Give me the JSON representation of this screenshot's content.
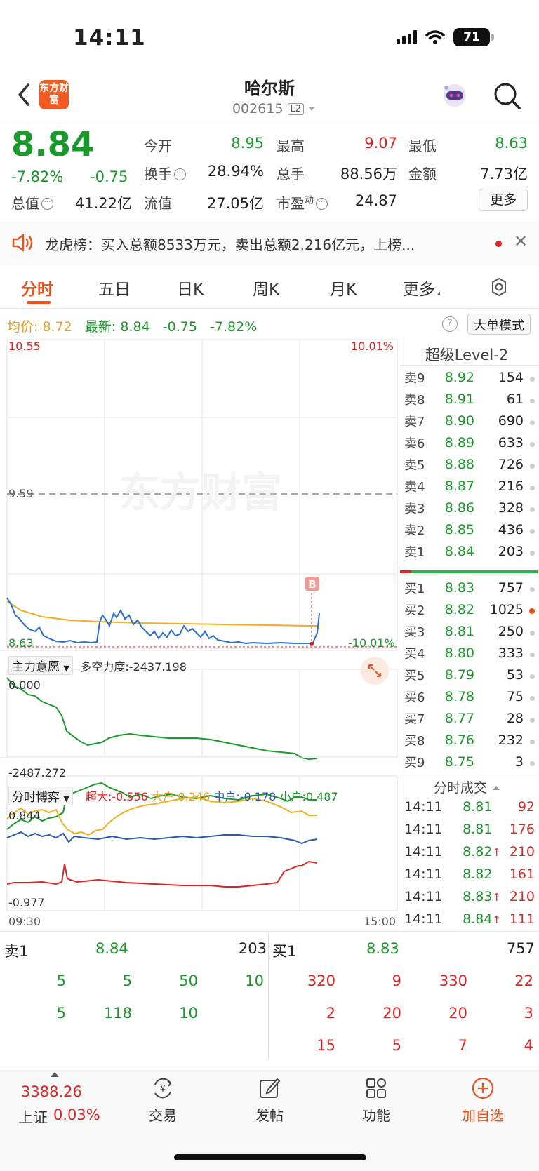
{
  "status_bar": {
    "time": "14:11",
    "battery": "71"
  },
  "header": {
    "logo_text": "东方财富",
    "stock_name": "哈尔斯",
    "stock_code": "002615",
    "level_badge": "L2"
  },
  "quote": {
    "price": "8.84",
    "change_pct": "-7.82%",
    "change": "-0.75",
    "fields": [
      {
        "label": "今开",
        "value": "8.95"
      },
      {
        "label": "最高",
        "value": "9.07"
      },
      {
        "label": "最低",
        "value": "8.63"
      },
      {
        "label": "换手",
        "value": "28.94%"
      },
      {
        "label": "总手",
        "value": "88.56万"
      },
      {
        "label": "金额",
        "value": "7.73亿"
      },
      {
        "label": "总值",
        "value": "41.22亿"
      },
      {
        "label": "流值",
        "value": "27.05亿"
      },
      {
        "label": "市盈",
        "label_sup": "动",
        "value": "24.87"
      }
    ],
    "more_label": "更多"
  },
  "notice": {
    "text": "龙虎榜：买入总额8533万元，卖出总额2.216亿元，上榜..."
  },
  "tabs": [
    "分时",
    "五日",
    "日K",
    "周K",
    "月K",
    "更多"
  ],
  "info_line": {
    "avg_label": "均价:",
    "avg_value": "8.72",
    "latest_label": "最新:",
    "latest_value": "8.84",
    "change": "-0.75",
    "change_pct": "-7.82%",
    "big_order_mode": "大单模式"
  },
  "chart": {
    "y_high": "10.55",
    "y_high_pct": "10.01%",
    "y_mid": "9.59",
    "y_low": "8.63",
    "y_low_pct": "-10.01%",
    "watermark": "东方财富",
    "b_marker": "B",
    "panel1_title": "主力意愿",
    "panel1_metric": "多空力度:-2437.198",
    "panel1_top": "0.000",
    "panel1_bottom": "-2487.272",
    "panel2_title": "分时博弈",
    "panel2_legend": [
      {
        "text": "超大:-0.556",
        "color": "#e02424"
      },
      {
        "text": "大户:0.246",
        "color": "#f0a020"
      },
      {
        "text": "中户:-0.178",
        "color": "#2a5aa8"
      },
      {
        "text": "小户:0.487",
        "color": "#1a9a2a"
      }
    ],
    "panel2_top": "0.844",
    "panel2_bottom": "-0.977",
    "time_start": "09:30",
    "time_end": "15:00",
    "colors": {
      "price": "#2a6fd0",
      "avg": "#f0b020",
      "power": "#1a9a2a",
      "grid": "#e6e6e6"
    }
  },
  "order_book": {
    "title": "超级Level-2",
    "sells": [
      {
        "label": "卖9",
        "price": "8.92",
        "volume": "154"
      },
      {
        "label": "卖8",
        "price": "8.91",
        "volume": "61"
      },
      {
        "label": "卖7",
        "price": "8.90",
        "volume": "690"
      },
      {
        "label": "卖6",
        "price": "8.89",
        "volume": "633"
      },
      {
        "label": "卖5",
        "price": "8.88",
        "volume": "726"
      },
      {
        "label": "卖4",
        "price": "8.87",
        "volume": "216"
      },
      {
        "label": "卖3",
        "price": "8.86",
        "volume": "328"
      },
      {
        "label": "卖2",
        "price": "8.85",
        "volume": "436"
      },
      {
        "label": "卖1",
        "price": "8.84",
        "volume": "203"
      }
    ],
    "buys": [
      {
        "label": "买1",
        "price": "8.83",
        "volume": "757"
      },
      {
        "label": "买2",
        "price": "8.82",
        "volume": "1025"
      },
      {
        "label": "买3",
        "price": "8.81",
        "volume": "250"
      },
      {
        "label": "买4",
        "price": "8.80",
        "volume": "333"
      },
      {
        "label": "买5",
        "price": "8.79",
        "volume": "53"
      },
      {
        "label": "买6",
        "price": "8.78",
        "volume": "75"
      },
      {
        "label": "买7",
        "price": "8.77",
        "volume": "28"
      },
      {
        "label": "买8",
        "price": "8.76",
        "volume": "232"
      },
      {
        "label": "买9",
        "price": "8.75",
        "volume": "3"
      }
    ]
  },
  "trades": {
    "title": "分时成交",
    "rows": [
      {
        "time": "14:11",
        "price": "8.81",
        "up": false,
        "volume": "92"
      },
      {
        "time": "14:11",
        "price": "8.81",
        "up": false,
        "volume": "176"
      },
      {
        "time": "14:11",
        "price": "8.82",
        "up": true,
        "volume": "210"
      },
      {
        "time": "14:11",
        "price": "8.82",
        "up": false,
        "volume": "161"
      },
      {
        "time": "14:11",
        "price": "8.83",
        "up": true,
        "volume": "210"
      },
      {
        "time": "14:11",
        "price": "8.84",
        "up": true,
        "volume": "111"
      }
    ]
  },
  "queue": {
    "sell_label": "卖1",
    "sell_price": "8.84",
    "sell_total": "203",
    "buy_label": "买1",
    "buy_price": "8.83",
    "buy_total": "757",
    "sell_orders": [
      [
        "5",
        "5",
        "50",
        "10"
      ],
      [
        "5",
        "118",
        "10",
        ""
      ]
    ],
    "buy_orders": [
      [
        "320",
        "9",
        "330",
        "22"
      ],
      [
        "2",
        "20",
        "20",
        "3"
      ],
      [
        "15",
        "5",
        "7",
        "4"
      ]
    ]
  },
  "bottom_nav": {
    "index_value": "3388.26",
    "index_name": "上证",
    "index_pct": "0.03%",
    "items": [
      {
        "label": "交易",
        "icon": "trade-icon"
      },
      {
        "label": "发帖",
        "icon": "post-icon"
      },
      {
        "label": "功能",
        "icon": "function-icon"
      },
      {
        "label": "加自选",
        "icon": "add-watchlist-icon"
      }
    ]
  }
}
